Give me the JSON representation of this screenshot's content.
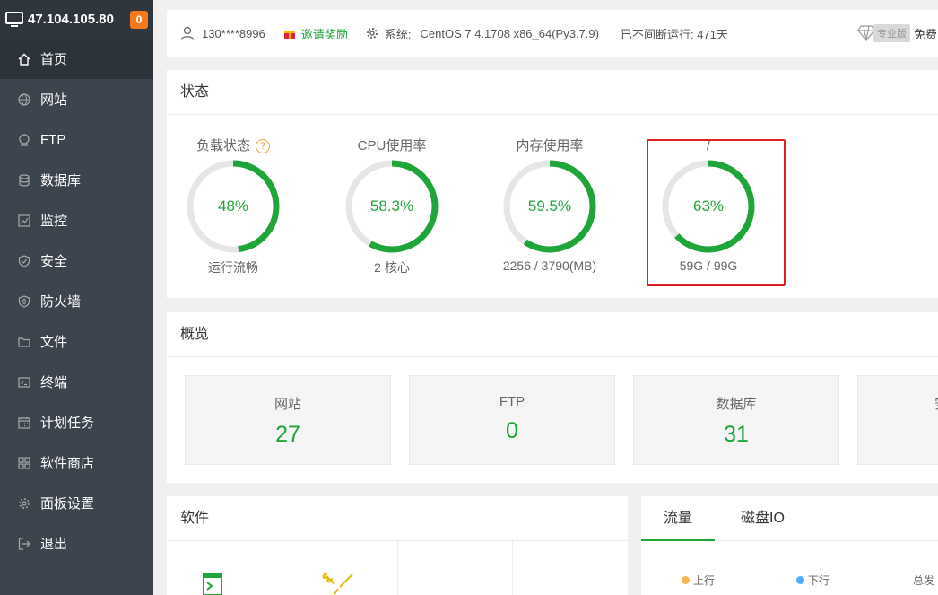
{
  "sidebar": {
    "ip": "47.104.105.80",
    "badge": "0",
    "items": [
      {
        "label": "首页",
        "icon": "home-icon"
      },
      {
        "label": "网站",
        "icon": "globe-icon"
      },
      {
        "label": "FTP",
        "icon": "ftp-icon"
      },
      {
        "label": "数据库",
        "icon": "database-icon"
      },
      {
        "label": "监控",
        "icon": "monitor-icon"
      },
      {
        "label": "安全",
        "icon": "shield-icon"
      },
      {
        "label": "防火墙",
        "icon": "firewall-icon"
      },
      {
        "label": "文件",
        "icon": "folder-icon"
      },
      {
        "label": "终端",
        "icon": "terminal-icon"
      },
      {
        "label": "计划任务",
        "icon": "calendar-icon"
      },
      {
        "label": "软件商店",
        "icon": "apps-icon"
      },
      {
        "label": "面板设置",
        "icon": "gear-icon"
      },
      {
        "label": "退出",
        "icon": "logout-icon"
      }
    ]
  },
  "topbar": {
    "user": "130****8996",
    "invite": "邀请奖励",
    "sys_label": "系统:",
    "sys": "CentOS 7.4.1708 x86_64(Py3.7.9)",
    "uptime": "已不间断运行: 471天",
    "pro": "专业版",
    "free": "免费"
  },
  "status": {
    "title": "状态",
    "gauges": [
      {
        "title": "负载状态",
        "value": "48%",
        "percent": 48,
        "sub": "运行流畅",
        "help": "?"
      },
      {
        "title": "CPU使用率",
        "value": "58.3%",
        "percent": 58.3,
        "sub": "2 核心"
      },
      {
        "title": "内存使用率",
        "value": "59.5%",
        "percent": 59.5,
        "sub": "2256 / 3790(MB)"
      },
      {
        "title": "/",
        "value": "63%",
        "percent": 63,
        "sub": "59G / 99G"
      }
    ]
  },
  "overview": {
    "title": "概览",
    "boxes": [
      {
        "label": "网站",
        "value": "27"
      },
      {
        "label": "FTP",
        "value": "0"
      },
      {
        "label": "数据库",
        "value": "31"
      },
      {
        "label": "安",
        "value": ""
      }
    ]
  },
  "software": {
    "title": "软件"
  },
  "traffic": {
    "tabs": [
      "流量",
      "磁盘IO"
    ],
    "legend": [
      "上行",
      "下行",
      "总发"
    ]
  },
  "colors": {
    "accent": "#20a53a",
    "sidebar": "#3c444d",
    "badge": "#f37b1d",
    "highlight": "#e02020",
    "up": "#f7b851",
    "down": "#52a9ff"
  }
}
